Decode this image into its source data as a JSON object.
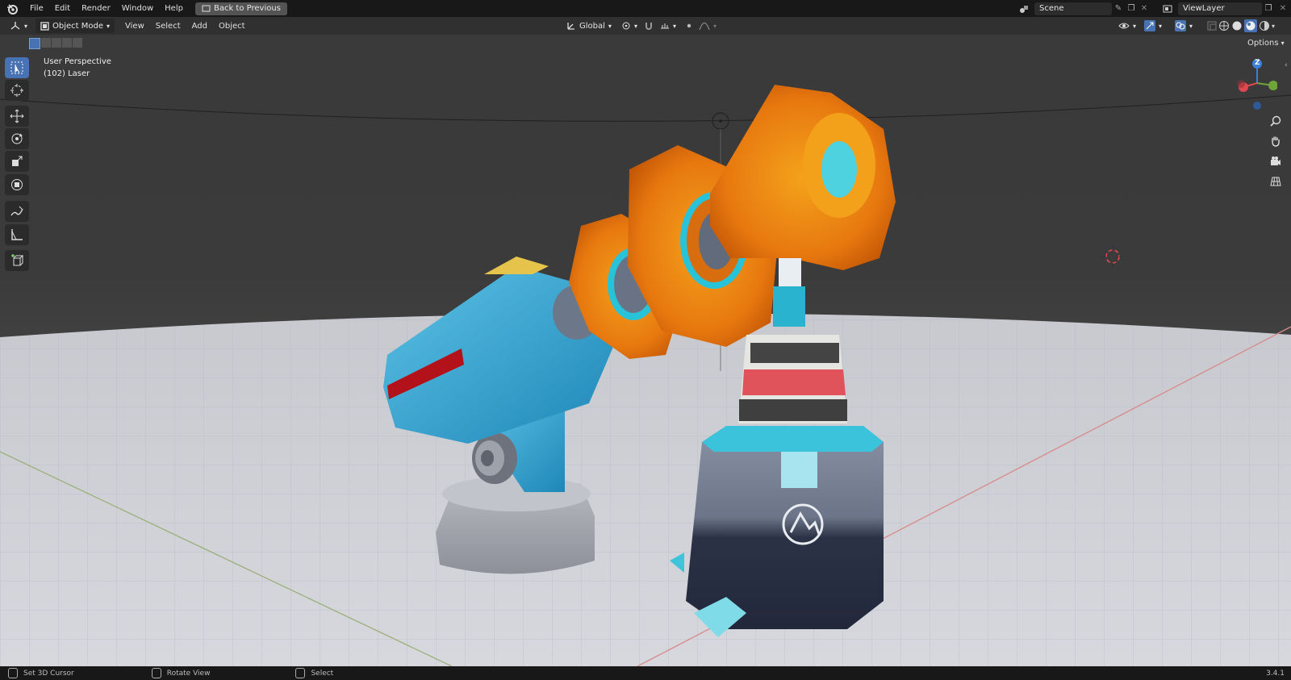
{
  "topbar": {
    "menus": [
      "File",
      "Edit",
      "Render",
      "Window",
      "Help"
    ],
    "back_button": "Back to Previous",
    "scene": "Scene",
    "view_layer": "ViewLayer"
  },
  "header": {
    "mode": "Object Mode",
    "menus": [
      "View",
      "Select",
      "Add",
      "Object"
    ],
    "transform_orientation": "Global",
    "options": "Options"
  },
  "viewport": {
    "perspective_label": "User Perspective",
    "object_label": "(102) Laser"
  },
  "gizmo": {
    "z": "Z"
  },
  "statusbar": {
    "left_action": "Set 3D Cursor",
    "middle_action": "Rotate View",
    "right_action": "Select",
    "version": "3.4.1"
  },
  "colors": {
    "active_tool": "#4772b3",
    "axis_x": "#e0474f",
    "axis_y": "#6fa43a",
    "axis_z": "#3c7fd6"
  }
}
